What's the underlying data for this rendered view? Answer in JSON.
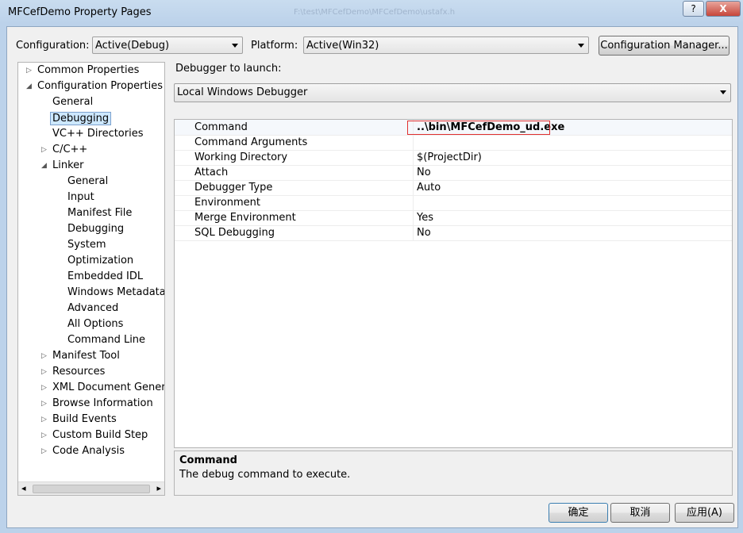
{
  "window": {
    "title": "MFCefDemo Property Pages",
    "ghost_title": "F:\\test\\MFCefDemo\\MFCefDemo\\ustafx.h",
    "help_glyph": "?",
    "close_glyph": "X"
  },
  "config": {
    "label": "Configuration:",
    "value": "Active(Debug)"
  },
  "platform": {
    "label": "Platform:",
    "value": "Active(Win32)"
  },
  "config_manager_label": "Configuration Manager...",
  "tree": {
    "items": [
      {
        "label": "Common Properties",
        "exp": "▷"
      },
      {
        "label": "Configuration Properties",
        "exp": "◢"
      },
      {
        "label": "General",
        "exp": ""
      },
      {
        "label": "Debugging",
        "exp": ""
      },
      {
        "label": "VC++ Directories",
        "exp": ""
      },
      {
        "label": "C/C++",
        "exp": "▷"
      },
      {
        "label": "Linker",
        "exp": "◢"
      },
      {
        "label": "General",
        "exp": ""
      },
      {
        "label": "Input",
        "exp": ""
      },
      {
        "label": "Manifest File",
        "exp": ""
      },
      {
        "label": "Debugging",
        "exp": ""
      },
      {
        "label": "System",
        "exp": ""
      },
      {
        "label": "Optimization",
        "exp": ""
      },
      {
        "label": "Embedded IDL",
        "exp": ""
      },
      {
        "label": "Windows Metadata",
        "exp": ""
      },
      {
        "label": "Advanced",
        "exp": ""
      },
      {
        "label": "All Options",
        "exp": ""
      },
      {
        "label": "Command Line",
        "exp": ""
      },
      {
        "label": "Manifest Tool",
        "exp": "▷"
      },
      {
        "label": "Resources",
        "exp": "▷"
      },
      {
        "label": "XML Document Generat",
        "exp": "▷"
      },
      {
        "label": "Browse Information",
        "exp": "▷"
      },
      {
        "label": "Build Events",
        "exp": "▷"
      },
      {
        "label": "Custom Build Step",
        "exp": "▷"
      },
      {
        "label": "Code Analysis",
        "exp": "▷"
      }
    ],
    "scroll_left": "◂",
    "scroll_right": "▸"
  },
  "debugger": {
    "label": "Debugger to launch:",
    "value": "Local Windows Debugger"
  },
  "properties": [
    {
      "name": "Command",
      "value": "..\\bin\\MFCefDemo_ud.exe"
    },
    {
      "name": "Command Arguments",
      "value": ""
    },
    {
      "name": "Working Directory",
      "value": "$(ProjectDir)"
    },
    {
      "name": "Attach",
      "value": "No"
    },
    {
      "name": "Debugger Type",
      "value": "Auto"
    },
    {
      "name": "Environment",
      "value": ""
    },
    {
      "name": "Merge Environment",
      "value": "Yes"
    },
    {
      "name": "SQL Debugging",
      "value": "No"
    }
  ],
  "description": {
    "title": "Command",
    "text": "The debug command to execute."
  },
  "buttons": {
    "ok": "确定",
    "cancel": "取消",
    "apply": "应用(A)"
  },
  "colors": {
    "highlight_border": "#e03030",
    "selection": "#cde8ff"
  }
}
